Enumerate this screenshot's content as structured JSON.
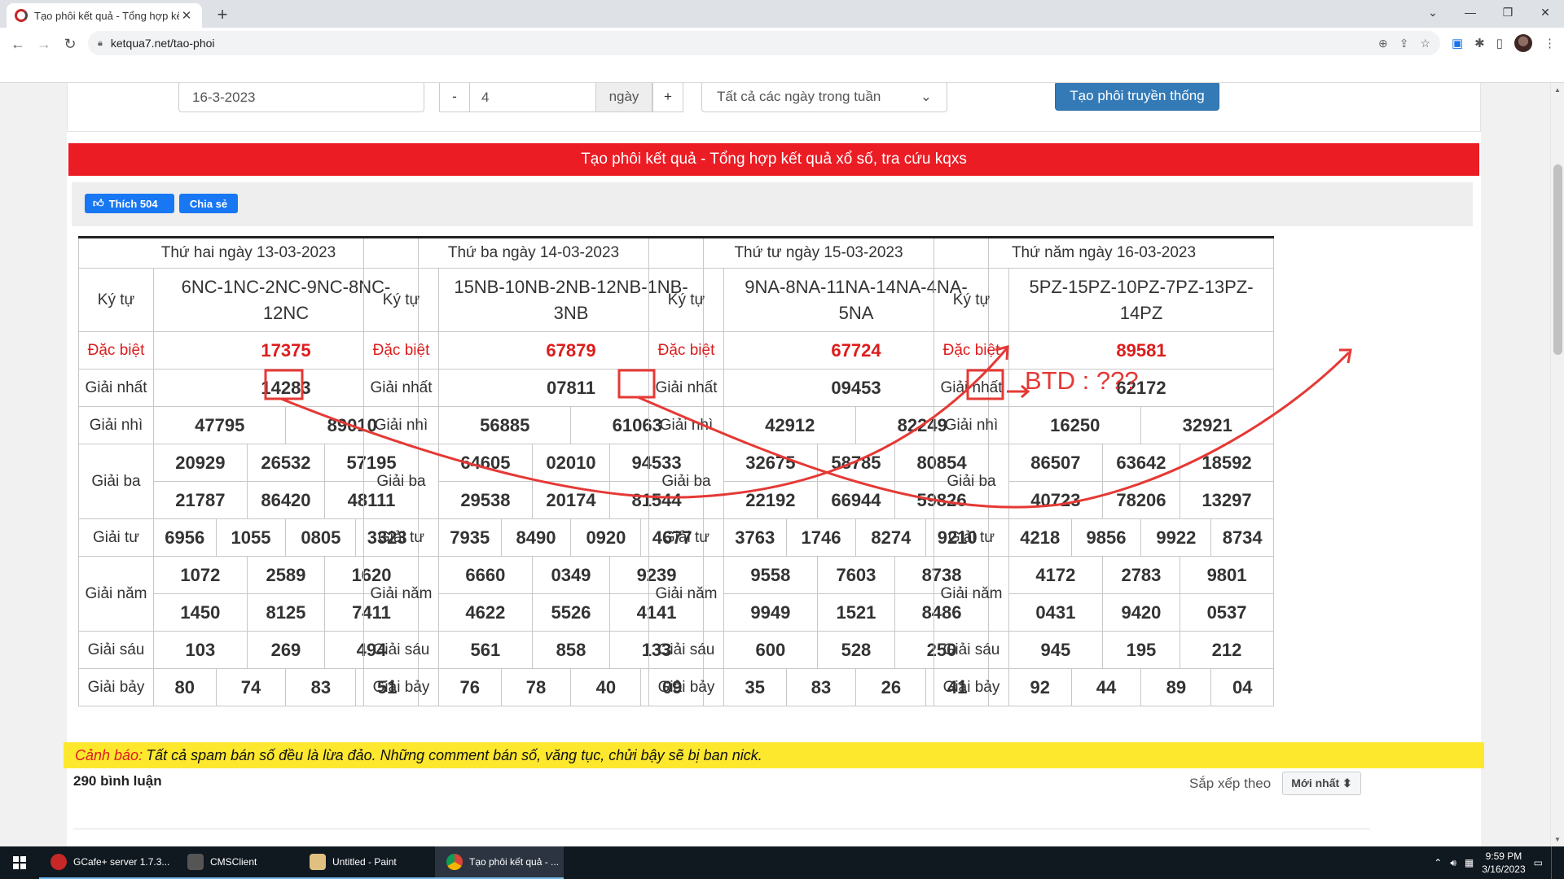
{
  "browser": {
    "tab_title": "Tạo phôi kết quả - Tổng hợp kết",
    "url": "ketqua7.net/tao-phoi",
    "window_controls": [
      "⌄",
      "—",
      "❐",
      "✕"
    ]
  },
  "form": {
    "date": "16-3-2023",
    "minus": "-",
    "days": "4",
    "unit": "ngày",
    "plus": "+",
    "weekday_select": "Tất cả các ngày trong tuần",
    "generate_button": "Tạo phôi truyền thống"
  },
  "banner": "Tạo phôi kết quả - Tổng hợp kết quả xổ số, tra cứu kqxs",
  "social": {
    "like": "Thích 504",
    "share": "Chia sẻ"
  },
  "labels": {
    "kytu": "Ký tự",
    "db": "Đặc biệt",
    "g1": "Giải nhất",
    "g2": "Giải nhì",
    "g3": "Giải ba",
    "g4": "Giải tư",
    "g5": "Giải năm",
    "g6": "Giải sáu",
    "g7": "Giải bảy"
  },
  "days": [
    {
      "header": "Thứ hai ngày 13-03-2023",
      "kytu": "6NC-1NC-2NC-9NC-8NC-12NC",
      "db": "17375",
      "g1": "14283",
      "g2": [
        "47795",
        "89010"
      ],
      "g3": [
        "20929",
        "26532",
        "57195",
        "21787",
        "86420",
        "48111"
      ],
      "g4": [
        "6956",
        "1055",
        "0805",
        "3323"
      ],
      "g5": [
        "1072",
        "2589",
        "1620",
        "1450",
        "8125",
        "7411"
      ],
      "g6": [
        "103",
        "269",
        "494"
      ],
      "g7": [
        "80",
        "74",
        "83",
        "51"
      ]
    },
    {
      "header": "Thứ ba ngày 14-03-2023",
      "kytu": "15NB-10NB-2NB-12NB-1NB-3NB",
      "db": "67879",
      "g1": "07811",
      "g2": [
        "56885",
        "61063"
      ],
      "g3": [
        "64605",
        "02010",
        "94533",
        "29538",
        "20174",
        "81544"
      ],
      "g4": [
        "7935",
        "8490",
        "0920",
        "4677"
      ],
      "g5": [
        "6660",
        "0349",
        "9239",
        "4622",
        "5526",
        "4141"
      ],
      "g6": [
        "561",
        "858",
        "133"
      ],
      "g7": [
        "76",
        "78",
        "40",
        "09"
      ]
    },
    {
      "header": "Thứ tư ngày 15-03-2023",
      "kytu": "9NA-8NA-11NA-14NA-4NA-5NA",
      "db": "67724",
      "g1": "09453",
      "g2": [
        "42912",
        "82249"
      ],
      "g3": [
        "32675",
        "58785",
        "80854",
        "22192",
        "66944",
        "59826"
      ],
      "g4": [
        "3763",
        "1746",
        "8274",
        "9210"
      ],
      "g5": [
        "9558",
        "7603",
        "8738",
        "9949",
        "1521",
        "8486"
      ],
      "g6": [
        "600",
        "528",
        "250"
      ],
      "g7": [
        "35",
        "83",
        "26",
        "41"
      ]
    },
    {
      "header": "Thứ năm ngày 16-03-2023",
      "kytu": "5PZ-15PZ-10PZ-7PZ-13PZ-14PZ",
      "db": "89581",
      "g1": "62172",
      "g2": [
        "16250",
        "32921"
      ],
      "g3": [
        "86507",
        "63642",
        "18592",
        "40723",
        "78206",
        "13297"
      ],
      "g4": [
        "4218",
        "9856",
        "9922",
        "8734"
      ],
      "g5": [
        "4172",
        "2783",
        "9801",
        "0431",
        "9420",
        "0537"
      ],
      "g6": [
        "945",
        "195",
        "212"
      ],
      "g7": [
        "92",
        "44",
        "89",
        "04"
      ]
    }
  ],
  "annotation": "BTD : ???",
  "annotation_color": "#e53935",
  "warning": {
    "label": "Cảnh báo:",
    "text": "Tất cả spam bán số đều là lừa đảo. Những comment bán số, văng tục, chửi bậy sẽ bị ban nick."
  },
  "comments": {
    "count": "290 bình luận",
    "sort_label": "Sắp xếp theo",
    "sort_value": "Mới nhất ⬍"
  },
  "taskbar": {
    "items": [
      "GCafe+ server 1.7.3...",
      "CMSClient",
      "Untitled - Paint",
      "Tạo phôi kết quả - ..."
    ],
    "time": "9:59 PM",
    "date": "3/16/2023"
  }
}
